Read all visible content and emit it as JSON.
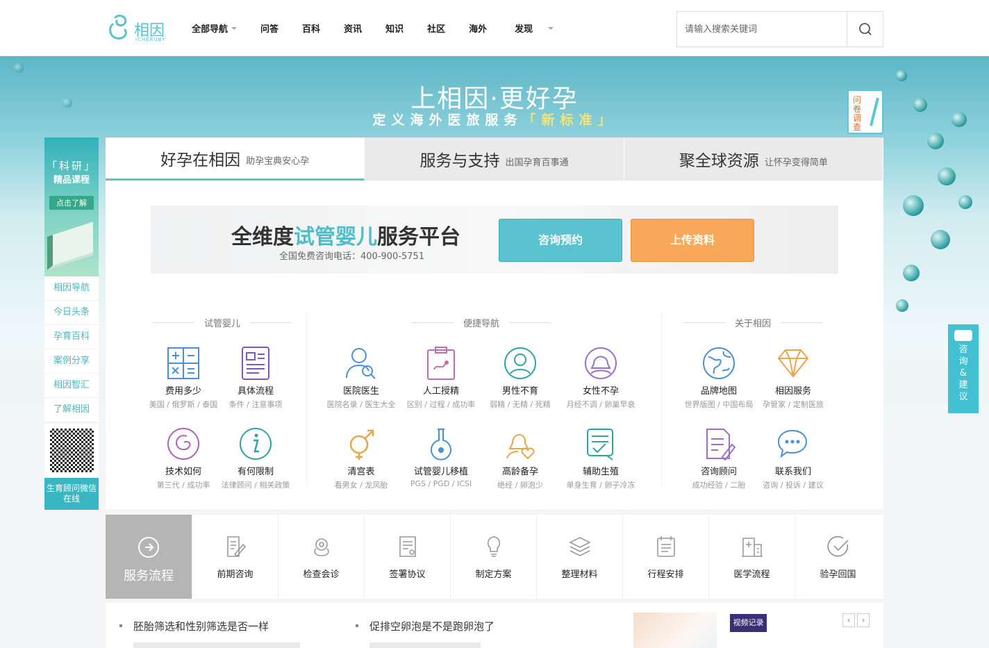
{
  "header": {
    "logo_text": "相因",
    "logo_sub": "ICHERUBY",
    "nav": [
      "全部导航",
      "问答",
      "百科",
      "资讯",
      "知识",
      "社区",
      "海外",
      "发现"
    ],
    "search_placeholder": "请输入搜索关键词"
  },
  "banner": {
    "title": "上相因·更好孕",
    "subtitle_a": "定义海外医旅服务",
    "subtitle_b": "「新标准」",
    "survey": "问卷调查"
  },
  "side": {
    "ad_line1": "「科研」",
    "ad_line2": "精品课程",
    "ad_button": "点击了解",
    "items": [
      "相因导航",
      "今日头条",
      "孕育百科",
      "案例分享",
      "相因智汇",
      "了解相因"
    ],
    "qr_label": "生育顾问微信在线"
  },
  "tabs": [
    {
      "title": "好孕在相因",
      "sub": "助孕宝典安心孕"
    },
    {
      "title": "服务与支持",
      "sub": "出国孕育百事通"
    },
    {
      "title": "聚全球资源",
      "sub": "让怀孕变得简单"
    }
  ],
  "platform": {
    "title_a": "全维度",
    "title_b": "试管婴儿",
    "title_c": "服务平台",
    "phone": "全国免费咨询电话：400-900-5751",
    "consult_btn": "咨询预约",
    "upload_btn": "上传资料"
  },
  "groups": {
    "ivf": "试管婴儿",
    "quick": "便捷导航",
    "about": "关于相因"
  },
  "quick_items": [
    {
      "label": "费用多少",
      "sub": "美国 / 俄罗斯 / 泰国"
    },
    {
      "label": "具体流程",
      "sub": "条件 / 注意事项"
    },
    {
      "label": "医院医生",
      "sub": "医院名录 / 医生大全"
    },
    {
      "label": "人工授精",
      "sub": "区别 / 过程 / 成功率"
    },
    {
      "label": "男性不育",
      "sub": "弱精 / 无精 / 死精"
    },
    {
      "label": "女性不孕",
      "sub": "月经不调 / 卵巢早衰"
    },
    {
      "label": "品牌地图",
      "sub": "世界版图 / 中国布局"
    },
    {
      "label": "相因服务",
      "sub": "孕管家 / 定制医旅"
    },
    {
      "label": "技术如何",
      "sub": "第三代 / 成功率"
    },
    {
      "label": "有何限制",
      "sub": "法律顾问 / 相关政策"
    },
    {
      "label": "清宫表",
      "sub": "看男女 / 龙凤胎"
    },
    {
      "label": "试管婴儿移植",
      "sub": "PGS / PGD / ICSI"
    },
    {
      "label": "高龄备孕",
      "sub": "绝经 / 卵泡少"
    },
    {
      "label": "辅助生殖",
      "sub": "单身生育 / 卵子冷冻"
    },
    {
      "label": "咨询顾问",
      "sub": "成功经验 / 二胎"
    },
    {
      "label": "联系我们",
      "sub": "咨询 / 投诉 / 建议"
    }
  ],
  "process": {
    "title": "服务流程",
    "steps": [
      "前期咨询",
      "检查会诊",
      "签署协议",
      "制定方案",
      "整理材料",
      "行程安排",
      "医学流程",
      "验孕回国"
    ]
  },
  "news": {
    "items": [
      "胚胎筛选和性别筛选是否一样",
      "促排空卵泡是不是跑卵泡了"
    ],
    "video_tag": "视频记录",
    "prev": "‹",
    "next": "›"
  },
  "float_btn": "咨询&建议",
  "colors": {
    "accent": "#56c4cf",
    "orange": "#f9a85a",
    "purple": "#b58bd8"
  }
}
